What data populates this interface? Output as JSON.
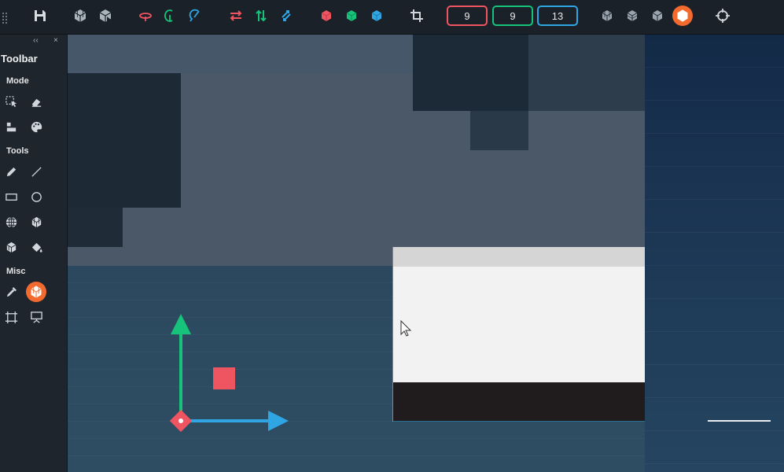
{
  "app": {
    "toolbar": {
      "icons": [
        "grip-handle",
        "save-icon",
        "cube-grid-icon",
        "cube-cut-icon",
        "rotate-x-icon",
        "rotate-y-icon",
        "rotate-z-icon",
        "flip-x-icon",
        "flip-y-icon",
        "flip-z-icon",
        "cube-red-icon",
        "cube-green-icon",
        "cube-blue-icon",
        "crop-icon",
        "cube-mode-1-icon",
        "cube-mode-2-icon",
        "cube-mode-3-icon",
        "hexagon-active-icon",
        "crosshair-icon"
      ],
      "spin_x": "9",
      "spin_y": "9",
      "spin_z": "13"
    },
    "panel": {
      "title": "Toolbar",
      "collapse_glyph": "‹‹",
      "close_glyph": "×",
      "sections": {
        "mode": "Mode",
        "tools": "Tools",
        "misc": "Misc"
      }
    },
    "colors": {
      "accent_orange": "#f26a2e",
      "axis_red": "#ef5461",
      "axis_green": "#17c27a",
      "axis_blue": "#2fa6e3",
      "panel_bg": "#1e252d"
    }
  }
}
